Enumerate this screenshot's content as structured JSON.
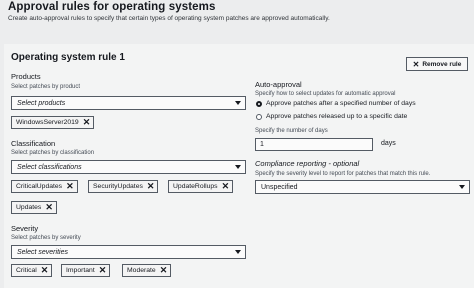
{
  "header": {
    "title": "Approval rules for operating systems",
    "subtitle": "Create auto-approval rules to specify that certain types of operating system patches are approved automatically."
  },
  "rule": {
    "title": "Operating system rule 1",
    "remove_label": "Remove rule",
    "remove_icon": "close-icon"
  },
  "products": {
    "label": "Products",
    "description": "Select patches by product",
    "placeholder": "Select products",
    "tokens": [
      "WindowsServer2019"
    ]
  },
  "classification": {
    "label": "Classification",
    "description": "Select patches by classification",
    "placeholder": "Select classifications",
    "tokens": [
      "CriticalUpdates",
      "SecurityUpdates",
      "UpdateRollups",
      "Updates"
    ]
  },
  "severity": {
    "label": "Severity",
    "description": "Select patches by severity",
    "placeholder": "Select severities",
    "tokens": [
      "Critical",
      "Important",
      "Moderate"
    ]
  },
  "auto_approval": {
    "label": "Auto-approval",
    "description": "Specify how to select updates for automatic approval",
    "options": [
      {
        "label": "Approve patches after a specified number of days",
        "selected": true
      },
      {
        "label": "Approve patches released up to a specific date",
        "selected": false
      }
    ],
    "days_label": "Specify the number of days",
    "days_value": "1",
    "days_unit": "days"
  },
  "compliance": {
    "label": "Compliance reporting - optional",
    "description": "Specify the severity level to report for patches that match this rule.",
    "value": "Unspecified"
  }
}
